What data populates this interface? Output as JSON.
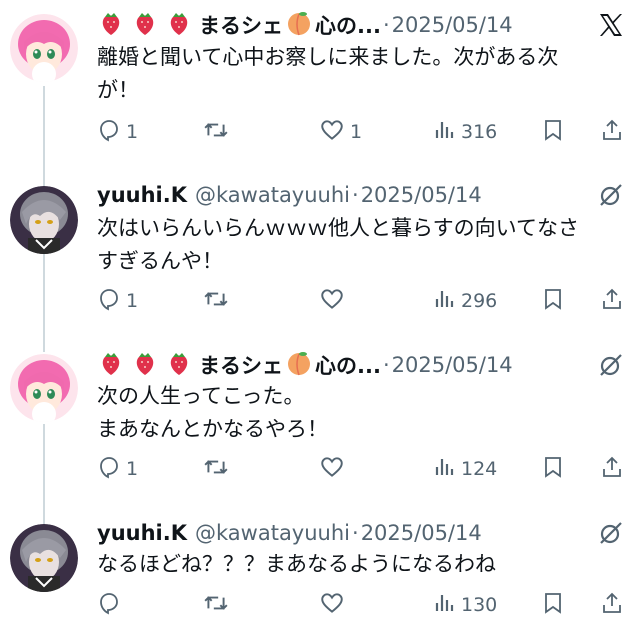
{
  "tweets": [
    {
      "name": "まるシェ",
      "name_tail": "心の...",
      "handle": "",
      "sep": "·",
      "date": "2025/05/14",
      "corner_icon": "x-logo-icon",
      "avatar": "pink-hair-anime-avatar",
      "text": "離婚と聞いて心中お察しに来ました。次がある次\nが！",
      "replies": "1",
      "retweets": "",
      "likes": "1",
      "views": "316"
    },
    {
      "name": "yuuhi.K",
      "name_tail": "",
      "handle": "@kawatayuuhi",
      "sep": "·",
      "date": "2025/05/14",
      "corner_icon": "grok-icon",
      "avatar": "gray-hair-anime-avatar",
      "text": "次はいらんいらんｗｗｗ他人と暮らすの向いてなさ\nすぎるんや！",
      "replies": "1",
      "retweets": "",
      "likes": "",
      "views": "296"
    },
    {
      "name": "まるシェ",
      "name_tail": "心の...",
      "handle": "",
      "sep": "·",
      "date": "2025/05/14",
      "corner_icon": "grok-icon",
      "avatar": "pink-hair-anime-avatar",
      "text": "次の人生ってこった。\nまあなんとかなるやろ！",
      "replies": "1",
      "retweets": "",
      "likes": "",
      "views": "124"
    },
    {
      "name": "yuuhi.K",
      "name_tail": "",
      "handle": "@kawatayuuhi",
      "sep": "·",
      "date": "2025/05/14",
      "corner_icon": "grok-icon",
      "avatar": "gray-hair-anime-avatar",
      "text": "なるほどね？？？まあなるようになるわね",
      "replies": "",
      "retweets": "",
      "likes": "",
      "views": "130"
    }
  ],
  "colors": {
    "text": "#0f1419",
    "muted": "#536471",
    "thread_line": "#cfd9de",
    "strawberry": "#e0314b",
    "peach": "#f4a261"
  }
}
